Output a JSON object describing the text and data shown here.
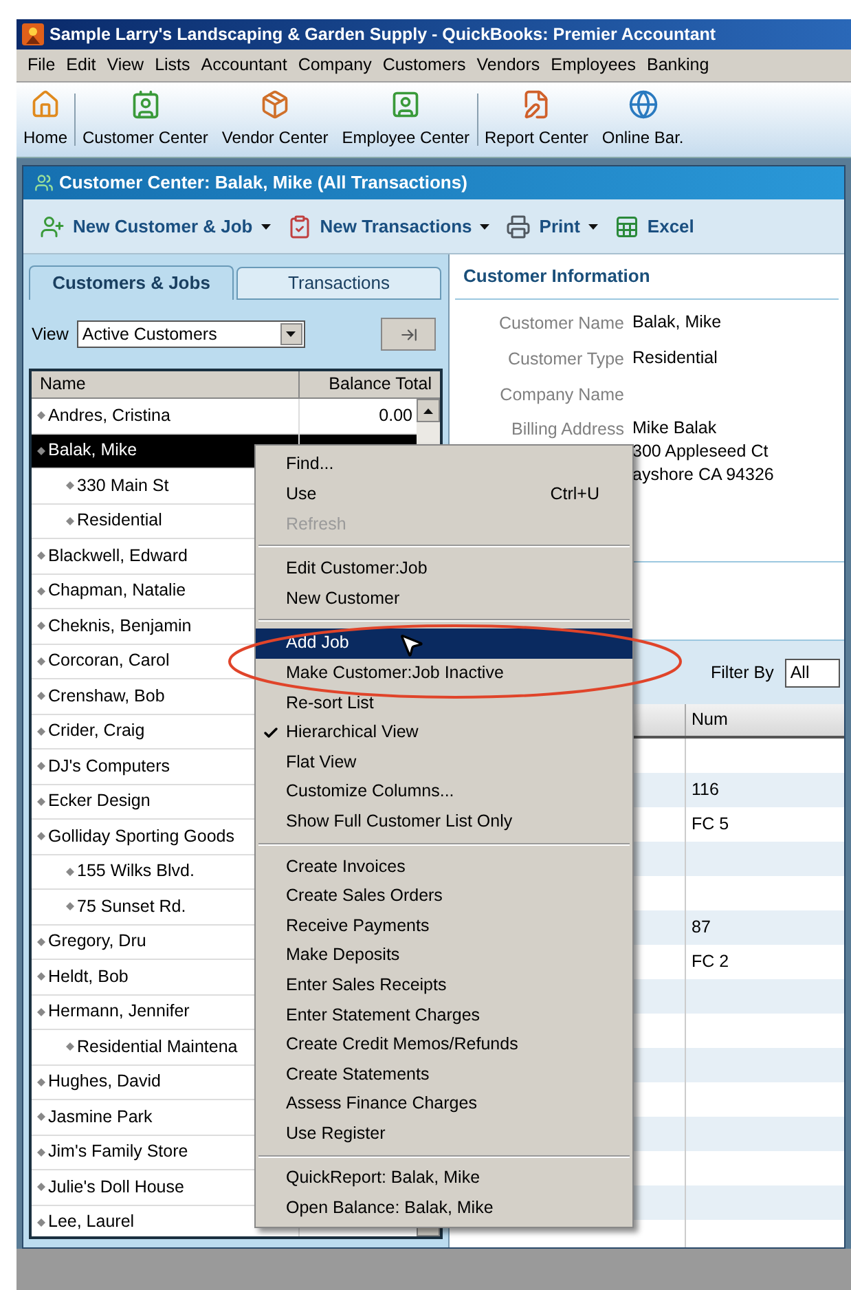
{
  "window": {
    "title": "Sample Larry's Landscaping & Garden Supply - QuickBooks: Premier Accountant"
  },
  "menu_bar": [
    "File",
    "Edit",
    "View",
    "Lists",
    "Accountant",
    "Company",
    "Customers",
    "Vendors",
    "Employees",
    "Banking"
  ],
  "toolbar": [
    {
      "kind": "home",
      "label": "Home"
    },
    {
      "kind": "customer",
      "label": "Customer Center"
    },
    {
      "kind": "vendor",
      "label": "Vendor Center"
    },
    {
      "kind": "employee",
      "label": "Employee Center"
    },
    {
      "kind": "report",
      "label": "Report Center"
    },
    {
      "kind": "online",
      "label": "Online Bar."
    }
  ],
  "center": {
    "title": "Customer Center: Balak, Mike (All Transactions)",
    "actions": [
      {
        "kind": "customer",
        "label": "New Customer & Job",
        "has_menu": true
      },
      {
        "kind": "transaction",
        "label": "New Transactions",
        "has_menu": true
      },
      {
        "kind": "print",
        "label": "Print",
        "has_menu": true
      },
      {
        "kind": "excel",
        "label": "Excel",
        "has_menu": false
      }
    ]
  },
  "tabs": [
    {
      "label": "Customers & Jobs",
      "selected": true
    },
    {
      "label": "Transactions",
      "selected": false
    }
  ],
  "view": {
    "label": "View",
    "value": "Active Customers"
  },
  "list": {
    "columns": [
      "Name",
      "Balance Total"
    ],
    "rows": [
      {
        "name": "Andres, Cristina",
        "balance": "0.00",
        "selected": false
      },
      {
        "name": "Balak, Mike",
        "selected": true,
        "children": [
          {
            "name": "330 Main St",
            "selected": false
          },
          {
            "name": "Residential",
            "selected": false
          }
        ]
      },
      {
        "name": "Blackwell, Edward",
        "selected": false
      },
      {
        "name": "Chapman, Natalie",
        "selected": false
      },
      {
        "name": "Cheknis, Benjamin",
        "selected": false
      },
      {
        "name": "Corcoran, Carol",
        "selected": false
      },
      {
        "name": "Crenshaw, Bob",
        "selected": false
      },
      {
        "name": "Crider, Craig",
        "selected": false
      },
      {
        "name": "DJ's Computers",
        "selected": false
      },
      {
        "name": "Ecker Design",
        "selected": false
      },
      {
        "name": "Golliday Sporting Goods",
        "selected": false,
        "children": [
          {
            "name": "155 Wilks Blvd.",
            "selected": false
          },
          {
            "name": "75 Sunset Rd.",
            "selected": false
          }
        ]
      },
      {
        "name": "Gregory, Dru",
        "selected": false
      },
      {
        "name": "Heldt, Bob",
        "selected": false
      },
      {
        "name": "Hermann, Jennifer",
        "selected": false,
        "children": [
          {
            "name": "Residential Maintena",
            "selected": false
          }
        ]
      },
      {
        "name": "Hughes, David",
        "selected": false
      },
      {
        "name": "Jasmine Park",
        "selected": false
      },
      {
        "name": "Jim's Family Store",
        "selected": false
      },
      {
        "name": "Julie's Doll House",
        "selected": false
      },
      {
        "name": "Lee, Laurel",
        "selected": false
      }
    ]
  },
  "customer_info": {
    "title": "Customer Information",
    "fields": [
      {
        "label": "Customer Name",
        "lines": [
          "Balak, Mike"
        ]
      },
      {
        "label": "Customer Type",
        "lines": [
          "Residential"
        ]
      },
      {
        "label": "Company Name"
      },
      {
        "label": "Billing Address",
        "lines": [
          "Mike Balak",
          "300 Appleseed Ct",
          "ayshore CA 94326"
        ]
      }
    ]
  },
  "transactions": {
    "filter_label": "Filter By",
    "filter_value": "All",
    "column": "Num",
    "rows": [
      {},
      {
        "num": "116"
      },
      {
        "num": "FC 5"
      },
      {},
      {},
      {
        "num": "87"
      },
      {
        "num": "FC 2"
      }
    ]
  },
  "context_menu": [
    {
      "kind": "item",
      "label": "Find...",
      "disabled": false
    },
    {
      "kind": "item",
      "label": "Use",
      "shortcut": "Ctrl+U",
      "disabled": false
    },
    {
      "kind": "item",
      "label": "Refresh",
      "disabled": true
    },
    {
      "kind": "separator"
    },
    {
      "kind": "item",
      "label": "Edit Customer:Job",
      "disabled": false
    },
    {
      "kind": "item",
      "label": "New Customer",
      "disabled": false
    },
    {
      "kind": "separator"
    },
    {
      "kind": "item",
      "label": "Add Job",
      "selected": true,
      "disabled": false
    },
    {
      "kind": "item",
      "label": "Make Customer:Job Inactive",
      "disabled": false
    },
    {
      "kind": "item",
      "label": "Re-sort List",
      "disabled": false
    },
    {
      "kind": "item",
      "label": "Hierarchical View",
      "checked": true,
      "disabled": false
    },
    {
      "kind": "item",
      "label": "Flat View",
      "checked": false,
      "disabled": false
    },
    {
      "kind": "item",
      "label": "Customize Columns...",
      "disabled": false
    },
    {
      "kind": "item",
      "label": "Show Full Customer List Only",
      "disabled": false
    },
    {
      "kind": "separator"
    },
    {
      "kind": "item",
      "label": "Create Invoices",
      "disabled": false
    },
    {
      "kind": "item",
      "label": "Create Sales Orders",
      "disabled": false
    },
    {
      "kind": "item",
      "label": "Receive Payments",
      "disabled": false
    },
    {
      "kind": "item",
      "label": "Make Deposits",
      "disabled": false
    },
    {
      "kind": "item",
      "label": "Enter Sales Receipts",
      "disabled": false
    },
    {
      "kind": "item",
      "label": "Enter Statement Charges",
      "disabled": false
    },
    {
      "kind": "item",
      "label": "Create Credit Memos/Refunds",
      "disabled": false
    },
    {
      "kind": "item",
      "label": "Create Statements",
      "disabled": false
    },
    {
      "kind": "item",
      "label": "Assess Finance Charges",
      "disabled": false
    },
    {
      "kind": "item",
      "label": "Use Register",
      "disabled": false
    },
    {
      "kind": "separator"
    },
    {
      "kind": "item",
      "label": "QuickReport: Balak, Mike",
      "disabled": false
    },
    {
      "kind": "item",
      "label": "Open Balance: Balak, Mike",
      "disabled": false
    }
  ]
}
